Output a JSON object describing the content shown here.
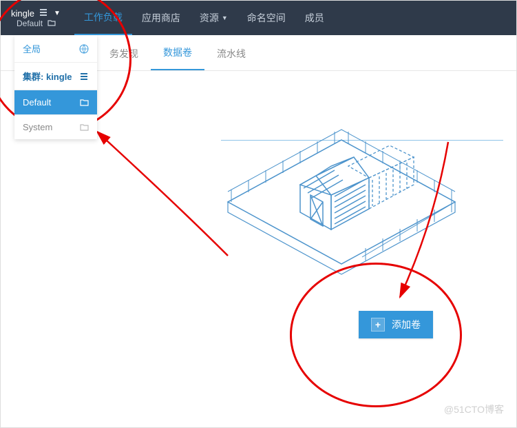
{
  "topbar": {
    "cluster": "kingle",
    "project": "Default",
    "nav": {
      "workload": "工作负载",
      "appstore": "应用商店",
      "resource": "资源",
      "namespace": "命名空间",
      "members": "成员"
    }
  },
  "dropdown": {
    "global": "全局",
    "cluster_prefix": "集群:",
    "cluster_name": "kingle",
    "project_default": "Default",
    "project_system": "System"
  },
  "subtabs": {
    "discovery_partial": "务发现",
    "volumes": "数据卷",
    "pipelines": "流水线"
  },
  "buttons": {
    "add_volume": "添加卷"
  },
  "watermark": "@51CTO博客"
}
